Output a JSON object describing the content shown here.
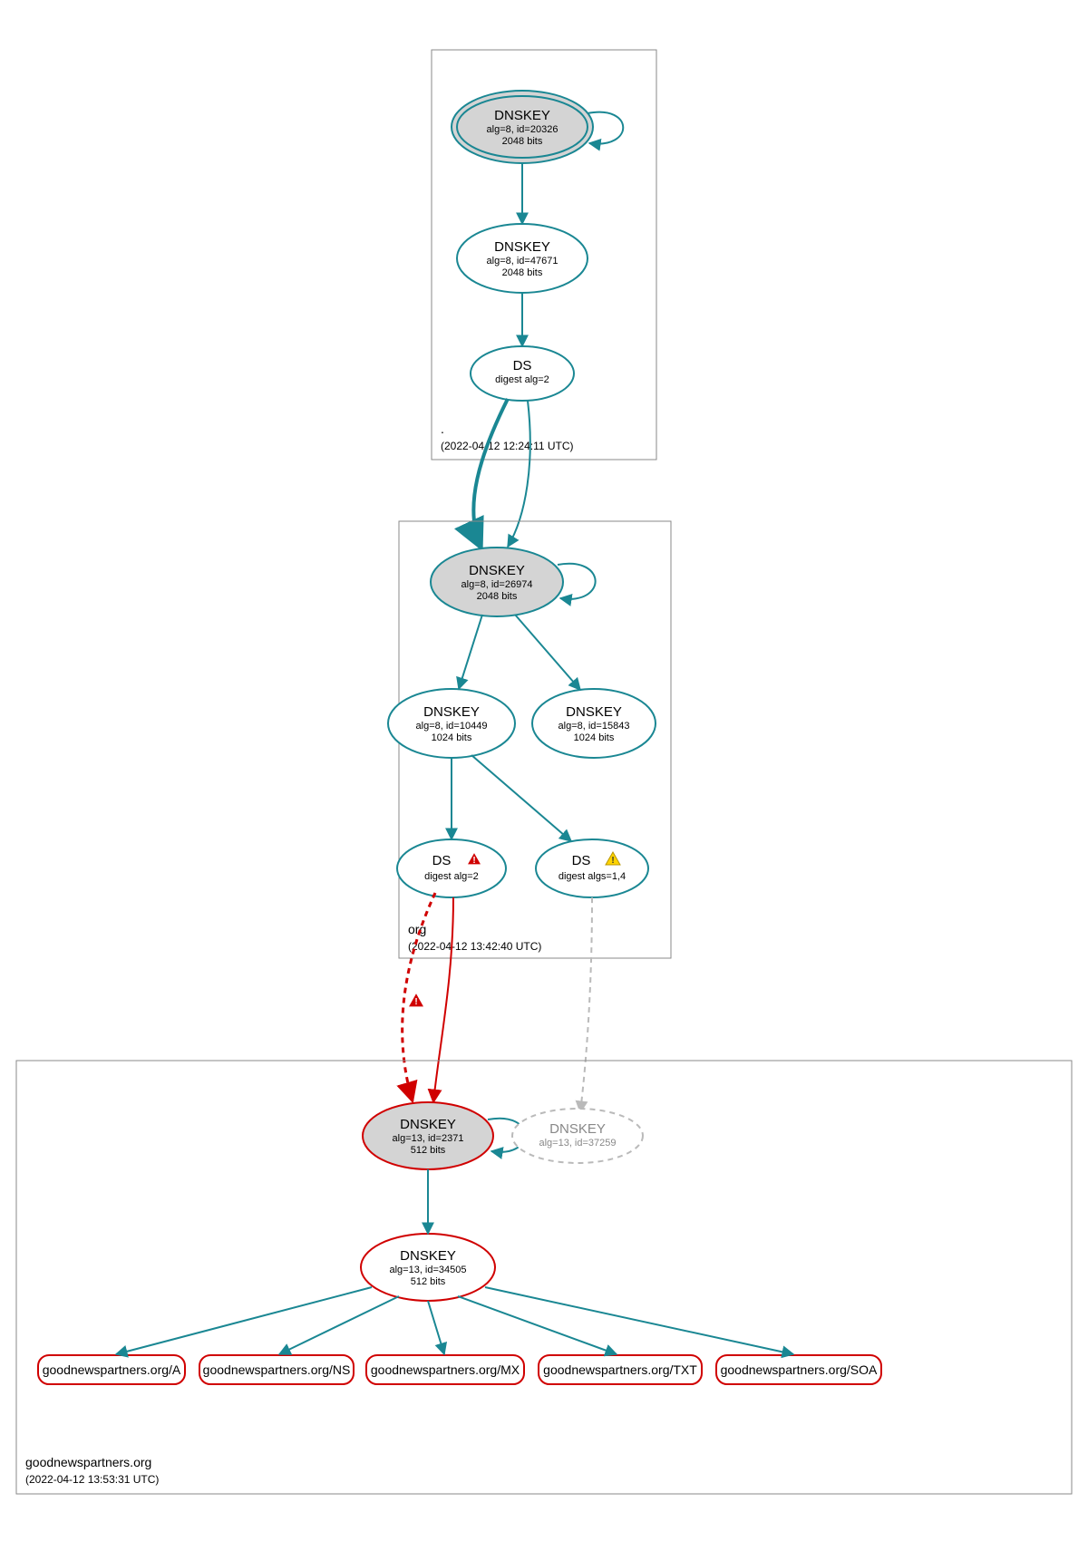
{
  "zones": {
    "root": {
      "name": ".",
      "timestamp": "(2022-04-12 12:24:11 UTC)"
    },
    "org": {
      "name": "org",
      "timestamp": "(2022-04-12 13:42:40 UTC)"
    },
    "domain": {
      "name": "goodnewspartners.org",
      "timestamp": "(2022-04-12 13:53:31 UTC)"
    }
  },
  "nodes": {
    "root_ksk": {
      "title": "DNSKEY",
      "line2": "alg=8, id=20326",
      "line3": "2048 bits"
    },
    "root_zsk": {
      "title": "DNSKEY",
      "line2": "alg=8, id=47671",
      "line3": "2048 bits"
    },
    "root_ds": {
      "title": "DS",
      "line2": "digest alg=2"
    },
    "org_ksk": {
      "title": "DNSKEY",
      "line2": "alg=8, id=26974",
      "line3": "2048 bits"
    },
    "org_zsk1": {
      "title": "DNSKEY",
      "line2": "alg=8, id=10449",
      "line3": "1024 bits"
    },
    "org_zsk2": {
      "title": "DNSKEY",
      "line2": "alg=8, id=15843",
      "line3": "1024 bits"
    },
    "org_ds1": {
      "title": "DS",
      "line2": "digest alg=2"
    },
    "org_ds2": {
      "title": "DS",
      "line2": "digest algs=1,4"
    },
    "dom_ksk": {
      "title": "DNSKEY",
      "line2": "alg=13, id=2371",
      "line3": "512 bits"
    },
    "dom_ghost": {
      "title": "DNSKEY",
      "line2": "alg=13, id=37259"
    },
    "dom_zsk": {
      "title": "DNSKEY",
      "line2": "alg=13, id=34505",
      "line3": "512 bits"
    }
  },
  "leaves": {
    "a": "goodnewspartners.org/A",
    "ns": "goodnewspartners.org/NS",
    "mx": "goodnewspartners.org/MX",
    "txt": "goodnewspartners.org/TXT",
    "soa": "goodnewspartners.org/SOA"
  }
}
